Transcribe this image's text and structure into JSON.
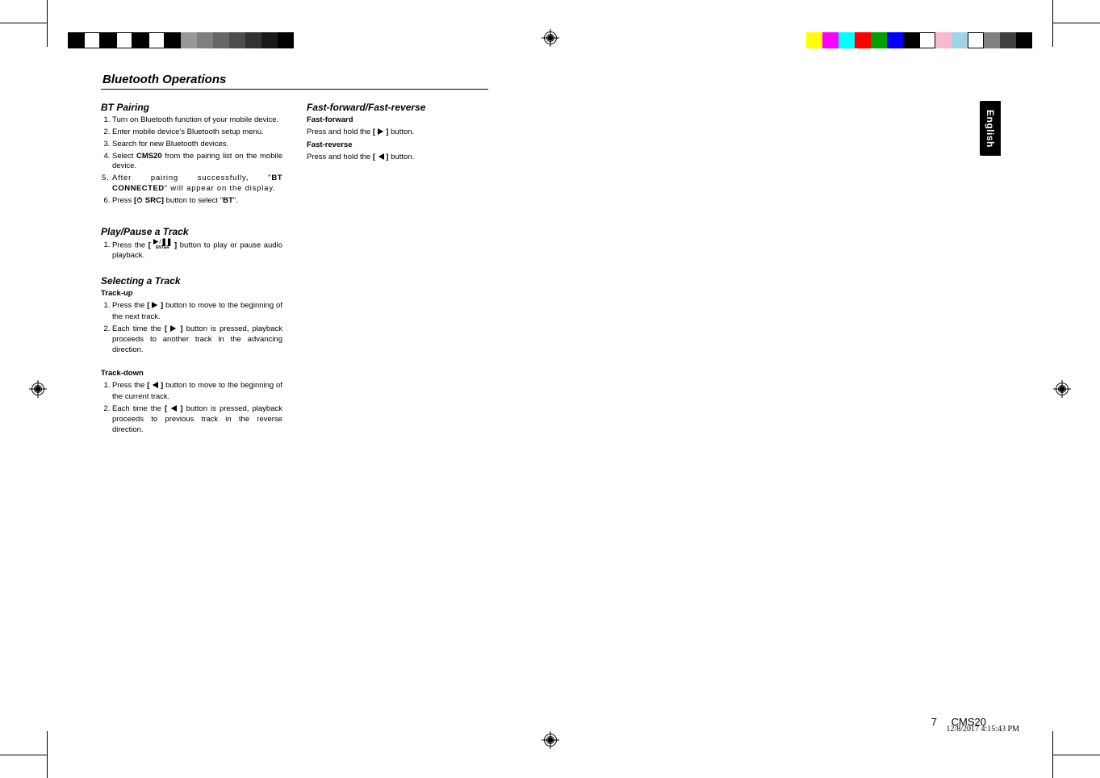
{
  "section_title": "Bluetooth Operations",
  "col1": {
    "h_pairing": "BT Pairing",
    "pair_steps": [
      "Turn on Bluetooth function of your mobile device.",
      "Enter mobile device's Bluetooth setup menu.",
      "Search for new Bluetooth devices.",
      {
        "pre": "Select ",
        "b1": "CMS20",
        "post": " from the pairing list on the mobile device."
      },
      {
        "pre": "After pairing successfully, \"",
        "b1": "BT CONNECTED",
        "post": "\" will appear on the display."
      },
      {
        "pre": "Press ",
        "b1": "[",
        "icon": "power",
        "b2": " SRC]",
        "mid": " button to select \"",
        "b3": "BT",
        "post": "\"."
      }
    ],
    "h_play": "Play/Pause a Track",
    "play_step_pre": "Press the ",
    "play_step_b_open": "[ ",
    "play_step_enter": "ENTER",
    "play_step_b_close": " ]",
    "play_step_post": " button to play or pause audio playback.",
    "h_select": "Selecting a Track",
    "trackup_label": "Track-up",
    "trackup": [
      {
        "pre": "Press the ",
        "b": "[  ",
        "icon": "right",
        "b2": "  ]",
        "post": " button to move to the beginning of the next track."
      },
      {
        "pre": "Each time the ",
        "b": "[  ",
        "icon": "right",
        "b2": "  ]",
        "post": " button is pressed, playback proceeds to another track in the advancing direction."
      }
    ],
    "trackdown_label": "Track-down",
    "trackdown": [
      {
        "pre": "Press the ",
        "b": "[  ",
        "icon": "left",
        "b2": "  ]",
        "post": " button to move to the beginning of the current track."
      },
      {
        "pre": "Each time the ",
        "b": "[  ",
        "icon": "left",
        "b2": "  ]",
        "post": " button is pressed, playback proceeds to previous track in the reverse direction."
      }
    ]
  },
  "col2": {
    "h_ff": "Fast-forward/Fast-reverse",
    "ff_label": "Fast-forward",
    "ff_pre": "Press and hold the ",
    "ff_b": "[  ",
    "ff_b2": "  ]",
    "ff_post": " button.",
    "fr_label": "Fast-reverse",
    "fr_pre": "Press and hold the ",
    "fr_b": "[  ",
    "fr_b2": "  ]",
    "fr_post": " button."
  },
  "side_tab": "English",
  "footer_page": "7",
  "footer_model": "CMS20",
  "timestamp": "12/8/2017   4:15:43 PM",
  "colorbars_left": [
    "#000000",
    "#ffffff",
    "#000000",
    "#ffffff",
    "#000000",
    "#ffffff",
    "#000000",
    "#989898",
    "#7f7f7f",
    "#666666",
    "#4d4d4d",
    "#333333",
    "#1a1a1a",
    "#000000"
  ],
  "colorbars_right": [
    "#ffff00",
    "#ff00ff",
    "#00ffff",
    "#ff0000",
    "#00a000",
    "#0000ff",
    "#000000",
    "#ffffff",
    "#f7b9d0",
    "#9ed3e8",
    "#ffffff",
    "#808080",
    "#404040",
    "#000000"
  ]
}
